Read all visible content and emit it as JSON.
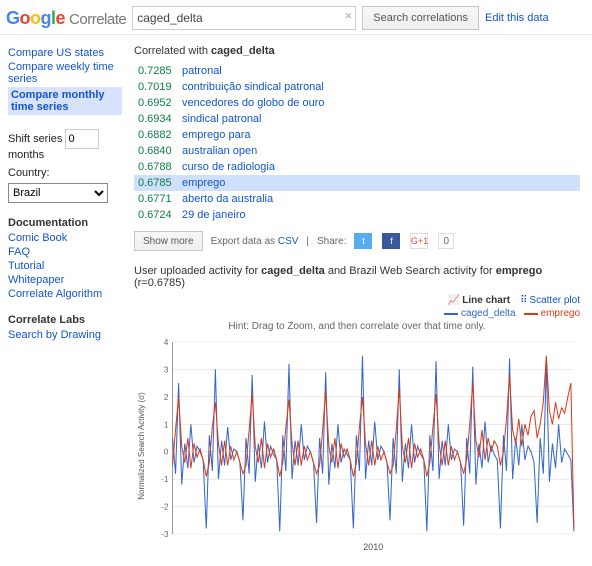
{
  "header": {
    "logo_sub": "Correlate",
    "search_value": "caged_delta",
    "search_btn": "Search correlations",
    "edit_link": "Edit this data"
  },
  "sidebar": {
    "nav": {
      "us_states": "Compare US states",
      "weekly": "Compare weekly time series",
      "monthly": "Compare monthly time series"
    },
    "shift_label_a": "Shift series",
    "shift_value": "0",
    "shift_label_b": "months",
    "country_label": "Country:",
    "country_value": "Brazil",
    "doc_head": "Documentation",
    "docs": {
      "comic": "Comic Book",
      "faq": "FAQ",
      "tutorial": "Tutorial",
      "whitepaper": "Whitepaper",
      "algo": "Correlate Algorithm"
    },
    "labs_head": "Correlate Labs",
    "labs": {
      "drawing": "Search by Drawing"
    }
  },
  "corr": {
    "head_prefix": "Correlated with ",
    "head_term": "caged_delta",
    "rows": [
      {
        "score": "0.7285",
        "term": "patronal"
      },
      {
        "score": "0.7019",
        "term": "contribuição sindical patronal"
      },
      {
        "score": "0.6952",
        "term": "vencedores do globo de ouro"
      },
      {
        "score": "0.6934",
        "term": "sindical patronal"
      },
      {
        "score": "0.6882",
        "term": "emprego para"
      },
      {
        "score": "0.6840",
        "term": "australian open"
      },
      {
        "score": "0.6788",
        "term": "curso de radiologia"
      },
      {
        "score": "0.6785",
        "term": "emprego"
      },
      {
        "score": "0.6771",
        "term": "aberto da australia"
      },
      {
        "score": "0.6724",
        "term": "29 de janeiro"
      }
    ],
    "highlight_index": 7
  },
  "toolbar": {
    "show_more": "Show more",
    "export_prefix": "Export data as ",
    "export_csv": "CSV",
    "share_label": "Share:",
    "share_count": "0"
  },
  "chart": {
    "desc_a": "User uploaded activity for ",
    "desc_term1": "caged_delta",
    "desc_b": " and Brazil Web Search activity for ",
    "desc_term2": "emprego",
    "desc_c": " (r=0.6785)",
    "view_line": "Line chart",
    "view_scatter": "Scatter plot",
    "legend1": "caged_delta",
    "legend2": "emprego",
    "hint": "Hint: Drag to Zoom, and then correlate over that time only.",
    "ylabel": "Normalized Search Activity (σ)",
    "xlabel": "2010",
    "y_ticks": [
      "4",
      "3",
      "2",
      "1",
      "0",
      "-1",
      "-2",
      "-3"
    ]
  },
  "chart_data": {
    "type": "line",
    "ylabel": "Normalized Search Activity (σ)",
    "ylim": [
      -3,
      4
    ],
    "x_tick": "2010",
    "series": [
      {
        "name": "caged_delta",
        "color": "#3366cc",
        "values": [
          0.5,
          -0.8,
          2.5,
          -1.2,
          0.3,
          -0.6,
          1.0,
          -0.4,
          0.2,
          0.0,
          -0.3,
          -2.8,
          0.6,
          -0.7,
          3.0,
          -1.0,
          0.4,
          -0.5,
          0.9,
          -0.3,
          0.1,
          0.0,
          -0.4,
          -2.5,
          0.5,
          -0.8,
          2.8,
          -1.1,
          0.3,
          -0.6,
          1.1,
          -0.4,
          0.2,
          -0.1,
          -0.3,
          -2.9,
          0.6,
          -0.7,
          3.2,
          -1.0,
          0.4,
          -0.5,
          1.0,
          -0.3,
          0.2,
          0.0,
          -0.4,
          -2.6,
          0.5,
          -0.8,
          2.9,
          -1.2,
          0.3,
          -0.6,
          1.0,
          -0.4,
          0.1,
          -0.1,
          -0.3,
          -2.8,
          0.6,
          -0.7,
          3.5,
          -1.0,
          0.4,
          -0.5,
          1.1,
          -0.3,
          0.2,
          0.0,
          -0.4,
          -2.5,
          0.5,
          -0.8,
          3.0,
          -1.1,
          0.3,
          -0.6,
          1.0,
          -0.4,
          0.2,
          -0.1,
          -0.3,
          -2.9,
          0.6,
          -0.7,
          3.3,
          -1.0,
          0.4,
          -0.5,
          1.0,
          -0.3,
          0.1,
          0.0,
          -0.4,
          -2.7,
          0.5,
          -0.8,
          3.1,
          -1.2,
          0.3,
          -0.6,
          1.1,
          -0.4,
          0.2,
          -0.1,
          -0.3,
          -2.8,
          0.6,
          -0.7,
          3.4,
          -1.0,
          0.5,
          -0.5,
          1.0,
          -0.3,
          0.2,
          0.0,
          -0.4,
          -2.6,
          0.5,
          -0.8,
          3.2,
          -1.1,
          0.3,
          -0.6,
          1.0,
          -0.4,
          0.1,
          -0.1,
          -0.3,
          -2.9
        ]
      },
      {
        "name": "emprego",
        "color": "#dc3912",
        "values": [
          -0.5,
          0.8,
          2.0,
          0.2,
          -0.4,
          0.5,
          -0.6,
          0.3,
          -0.2,
          0.1,
          -0.3,
          -0.9,
          -0.4,
          0.9,
          1.8,
          0.3,
          -0.5,
          0.4,
          -0.5,
          0.2,
          -0.3,
          0.0,
          -0.4,
          -0.8,
          -0.5,
          0.8,
          2.1,
          0.2,
          -0.4,
          0.5,
          -0.6,
          0.3,
          -0.2,
          0.1,
          -0.3,
          -0.9,
          -0.4,
          0.9,
          1.9,
          0.3,
          -0.5,
          0.4,
          -0.5,
          0.2,
          -0.3,
          0.0,
          -0.4,
          -0.8,
          -0.5,
          0.8,
          2.2,
          0.2,
          -0.4,
          0.5,
          -0.6,
          0.3,
          -0.2,
          0.1,
          -0.3,
          -0.9,
          -0.4,
          0.9,
          2.0,
          0.3,
          -0.5,
          0.4,
          -0.5,
          0.2,
          -0.3,
          0.0,
          -0.4,
          -0.8,
          -0.5,
          0.8,
          2.3,
          0.2,
          -0.4,
          0.5,
          -0.6,
          0.3,
          -0.2,
          0.1,
          -0.3,
          -0.9,
          -0.4,
          0.9,
          2.1,
          0.3,
          -0.5,
          0.4,
          -0.5,
          0.2,
          -0.3,
          0.0,
          -0.4,
          -0.8,
          -0.3,
          1.0,
          2.5,
          0.4,
          -0.2,
          0.8,
          -0.3,
          0.5,
          0.0,
          0.4,
          0.2,
          -0.5,
          0.0,
          1.2,
          2.8,
          0.8,
          0.3,
          1.2,
          0.2,
          1.0,
          0.6,
          1.3,
          1.5,
          0.5,
          1.0,
          1.8,
          3.5,
          1.5,
          1.0,
          1.8,
          1.2,
          1.6,
          1.4,
          2.0,
          2.5,
          -2.8
        ]
      }
    ]
  }
}
